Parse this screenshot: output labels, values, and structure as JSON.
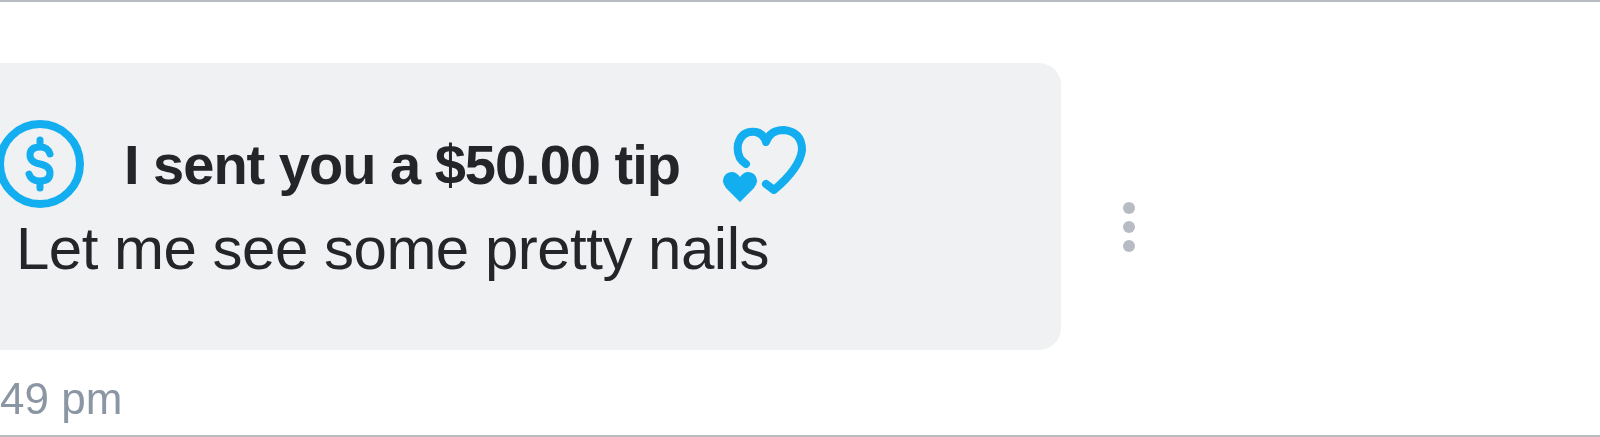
{
  "message": {
    "tip_title": "I sent you a $50.00 tip",
    "text": "Let me see some pretty nails",
    "time": "49 pm"
  }
}
